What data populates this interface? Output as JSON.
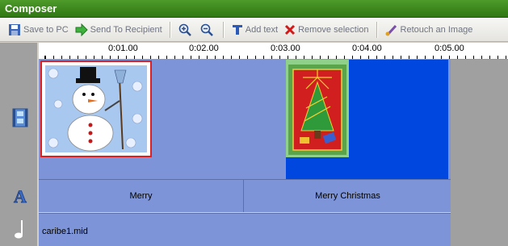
{
  "window": {
    "title": "Composer"
  },
  "toolbar": {
    "save_label": "Save to PC",
    "send_label": "Send To Recipient",
    "zoom_in_icon": "zoom-in-icon",
    "zoom_out_icon": "zoom-out-icon",
    "add_text_label": "Add text",
    "remove_label": "Remove selection",
    "retouch_label": "Retouch an Image"
  },
  "ruler": {
    "marks": [
      "0:01.00",
      "0:02.00",
      "0:03.00",
      "0:04.00",
      "0:05.00"
    ]
  },
  "tracks": {
    "video_icon": "film-icon",
    "text_icon": "letter-a-icon",
    "music_icon": "music-note-icon",
    "text_segments": [
      "Merry",
      "Merry Christmas"
    ],
    "music_file": "caribe1.mid"
  },
  "colors": {
    "title_bar": "#2f7713",
    "track_bg": "#7d95d8",
    "selection_blue": "#0047e0",
    "selection_green": "#8fd08a",
    "clip_border_red": "#e02020"
  }
}
